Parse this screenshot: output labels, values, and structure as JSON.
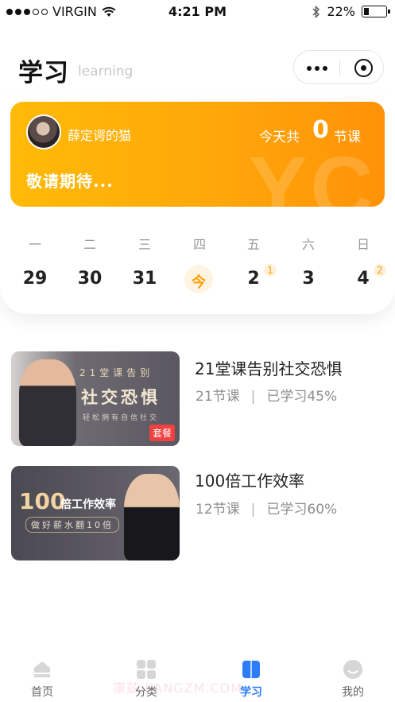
{
  "status_bar": {
    "carrier": "VIRGIN",
    "time": "4:21 PM",
    "battery": "22%",
    "battery_level": 0.22
  },
  "header": {
    "title": "学习",
    "subtitle": "learning"
  },
  "card": {
    "user_name": "薛定谔的猫",
    "today_label": "今天共",
    "today_count": "0",
    "today_unit": "节课",
    "message": "敬请期待...",
    "watermark": "YC.",
    "colors": {
      "start": "#ffba07",
      "end": "#ff9208"
    }
  },
  "week": {
    "days": [
      "一",
      "二",
      "三",
      "四",
      "五",
      "六",
      "日"
    ],
    "dates": [
      "29",
      "30",
      "31",
      "今",
      "2",
      "3",
      "4"
    ],
    "badges": {
      "fri": "1",
      "sun": "2"
    }
  },
  "courses": [
    {
      "title": "21堂课告别社交恐惧",
      "lessons": "21节课",
      "progress": "已学习45%",
      "thumb_line1": "21堂课告别",
      "thumb_line2": "社交恐惧",
      "thumb_line3": "轻松拥有自信社交",
      "thumb_tag": "套餐"
    },
    {
      "title": "100倍工作效率",
      "lessons": "12节课",
      "progress": "已学习60%",
      "thumb_big": "100",
      "thumb_line1": "倍工作效率",
      "thumb_line2": "做好薪水翻10倍"
    }
  ],
  "tabbar": {
    "tabs": [
      "首页",
      "分类",
      "学习",
      "我的"
    ],
    "active": "学习",
    "watermark": "康兹·KANGZM.COM",
    "active_color": "#2e7cf6"
  }
}
